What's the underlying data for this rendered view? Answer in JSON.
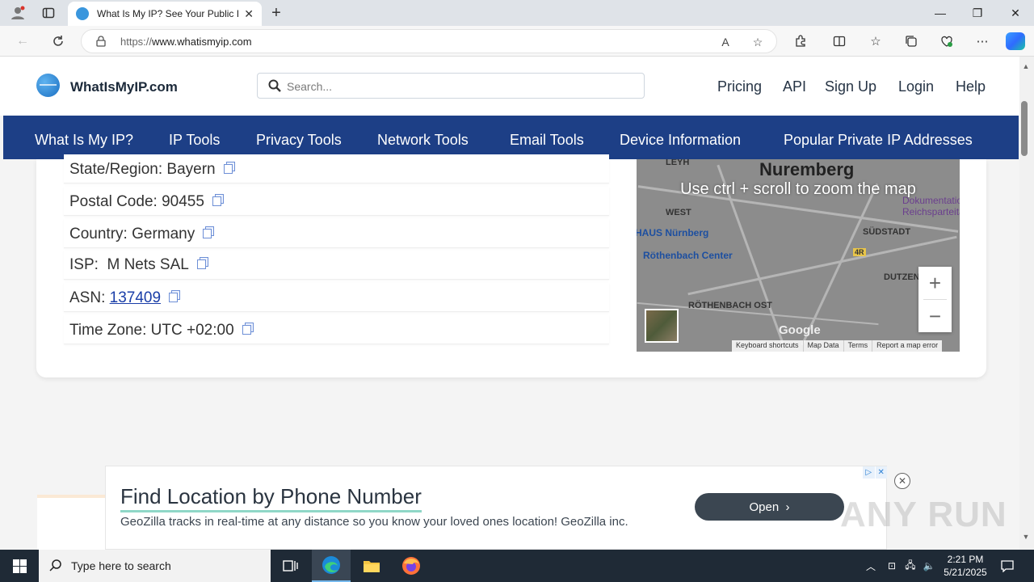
{
  "browser": {
    "tab_title": "What Is My IP? See Your Public IP",
    "url_prefix": "https://",
    "url_host": "www.whatismyip.com",
    "read_aloud_label": "A"
  },
  "site": {
    "logo_text": "WhatIsMyIP.com",
    "search_placeholder": "Search...",
    "header_links": [
      "Pricing",
      "API",
      "Sign Up",
      "Login",
      "Help"
    ],
    "nav_items": [
      "What Is My IP?",
      "IP Tools",
      "Privacy Tools",
      "Network Tools",
      "Email Tools",
      "Device Information",
      "Popular Private IP Addresses"
    ]
  },
  "details": {
    "state_label": "State/Region:",
    "state_value": "Bayern",
    "postal_label": "Postal Code:",
    "postal_value": "90455",
    "country_label": "Country:",
    "country_value": "Germany",
    "isp_label": "ISP:",
    "isp_value": "M Nets SAL",
    "asn_label": "ASN:",
    "asn_value": "137409",
    "tz_label": "Time Zone:",
    "tz_value": "UTC +02:00"
  },
  "map": {
    "city": "Nuremberg",
    "overlay": "Use ctrl + scroll to zoom the map",
    "labels": [
      "LEYH",
      "WEST",
      "SÜDSTADT",
      "DUTZEND",
      "HAUS Nürnberg",
      "Röthenbach Center",
      "RÖTHENBACH OST",
      "Dokumentations",
      "Reichsparteitag",
      "4R"
    ],
    "google": "Google",
    "footer": [
      "Keyboard shortcuts",
      "Map Data",
      "Terms",
      "Report a map error"
    ],
    "zoom_in": "+",
    "zoom_out": "−"
  },
  "ad": {
    "title": "Find Location by Phone Number",
    "body": "GeoZilla tracks in real-time at any distance so you know your loved ones location! GeoZilla inc.",
    "open_label": "Open",
    "watermark": "ANY RUN"
  },
  "taskbar": {
    "search_placeholder": "Type here to search",
    "time": "2:21 PM",
    "date": "5/21/2025"
  }
}
